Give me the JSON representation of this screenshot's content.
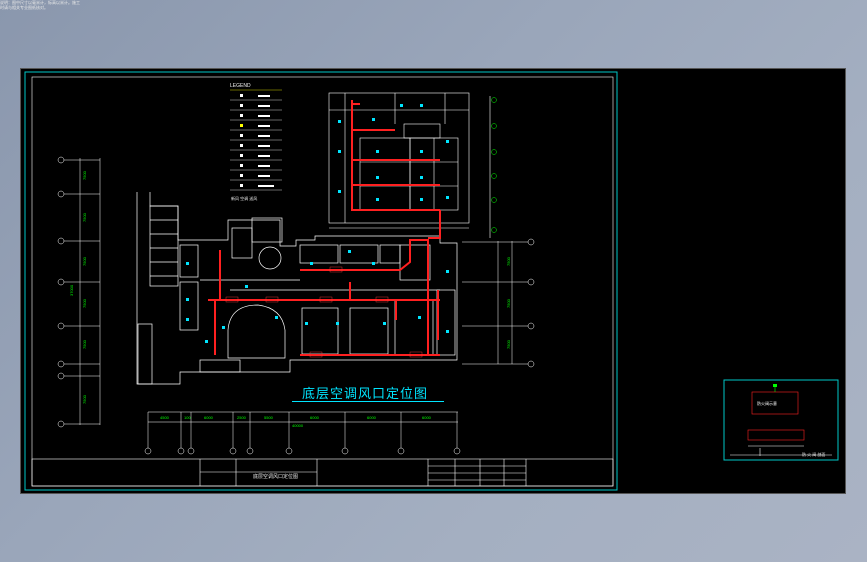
{
  "drawing": {
    "title": "底层空调风口定位图",
    "legend_heading": "LEGEND",
    "legend_caption": "新风  空调  送风",
    "titleblock_title": "底层空调风口定位图",
    "titleblock_note": "说明：图中尺寸以毫米计，标高以米计。施工时请与相关专业图纸核对。",
    "dims_bottom": [
      "4500",
      "100",
      "6000",
      "2500",
      "5500",
      "4500",
      "6000",
      "6000"
    ],
    "dims_bottom_total": "40000",
    "dims_left": [
      "7500",
      "7500",
      "7500",
      "7500",
      "7500",
      "7500"
    ],
    "dims_left_total": "37000",
    "dims_right": [
      "7500",
      "7500",
      "7500"
    ],
    "viewport_caption": "防火阀示意",
    "viewport_footer": "防 火 阀 剖面"
  },
  "colors": {
    "background": "#000000",
    "walls": "#ffffff",
    "duct": "#ff2020",
    "diffuser": "#00e5ff",
    "frame": "#00c8c8",
    "accent_green": "#00ff00"
  }
}
